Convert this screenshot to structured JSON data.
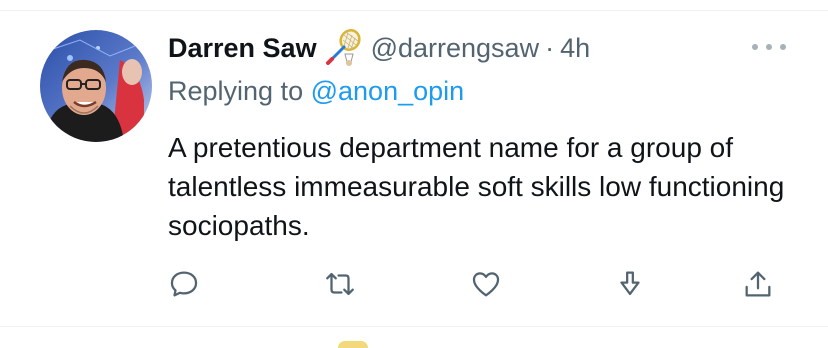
{
  "tweet": {
    "author": {
      "display_name": "Darren Saw",
      "handle": "@darrengsaw",
      "badge_icon": "badminton-racket-emoji"
    },
    "separator": "·",
    "time_ago": "4h",
    "reply_prefix": "Replying to",
    "reply_to": "@anon_opin",
    "text": "A pretentious department name for a group of talentless immeasurable soft skills low functioning sociopaths.",
    "actions": [
      "reply-icon",
      "retweet-icon",
      "like-icon",
      "share-icon",
      "upload-icon"
    ]
  },
  "colors": {
    "text_primary": "#0f1419",
    "text_secondary": "#536471",
    "link": "#1d9bf0",
    "icon": "#536471",
    "divider": "#eff3f4"
  }
}
